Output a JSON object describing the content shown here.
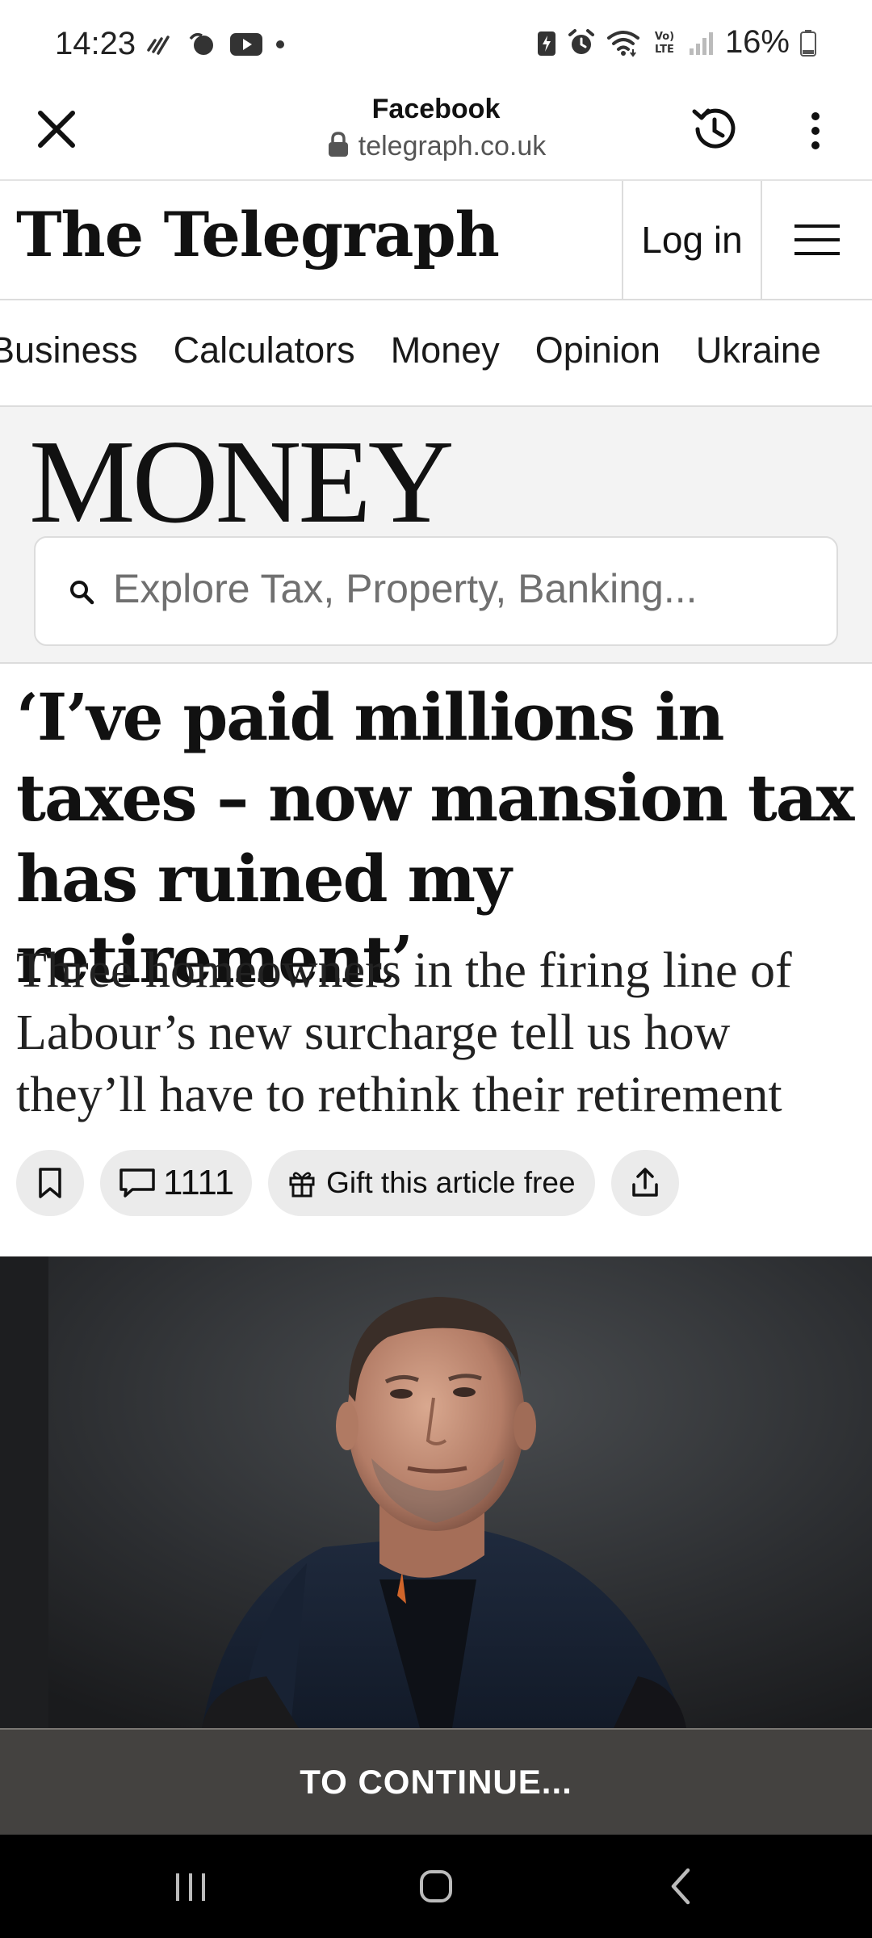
{
  "status_bar": {
    "time": "14:23",
    "battery_text": "16%",
    "left_icons": [
      "signal-wave-icon",
      "hand-ball-icon",
      "youtube-icon",
      "dot-icon"
    ],
    "right_icons": [
      "battery-saver-icon",
      "alarm-icon",
      "wifi-icon",
      "volte-icon",
      "cell-signal-icon",
      "battery-icon"
    ],
    "volte_label": "Vo)\nLTE"
  },
  "browser": {
    "title": "Facebook",
    "url": "telegraph.co.uk"
  },
  "site": {
    "logo": "The Telegraph",
    "login_label": "Log in"
  },
  "section_nav": {
    "items": [
      "Business",
      "Calculators",
      "Money",
      "Opinion",
      "Ukraine"
    ]
  },
  "money_section": {
    "title": "MONEY",
    "search_placeholder": "Explore Tax, Property, Banking..."
  },
  "article": {
    "headline": "‘I’ve paid millions in taxes – now mansion tax has ruined my retirement’",
    "standfirst": "Three homeowners in the firing line of Labour’s new surcharge tell us how they’ll have to rethink their retirement",
    "comment_count": "1111",
    "gift_label": "Gift this article free"
  },
  "overlay": {
    "continue_label": "TO CONTINUE..."
  },
  "colors": {
    "band_background": "#f3f3f3",
    "pill_background": "#ebebeb",
    "continue_bar": "#3c3a38",
    "nav_bar": "#000000"
  }
}
